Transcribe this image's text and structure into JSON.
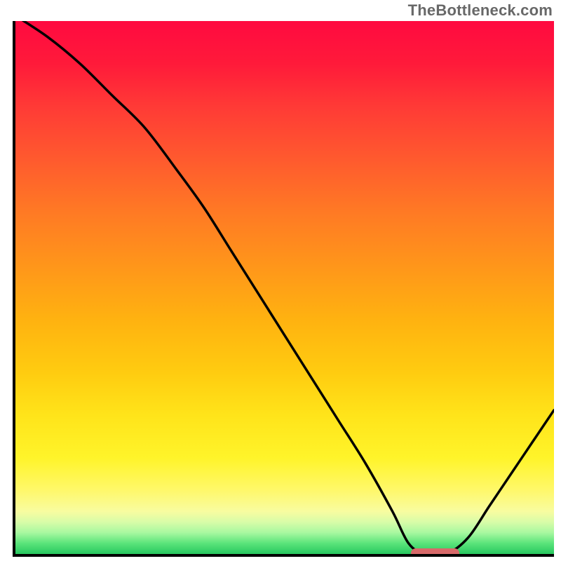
{
  "watermark": "TheBottleneck.com",
  "colors": {
    "axis": "#000000",
    "curve": "#000000",
    "marker": "#d86a6a",
    "gradient_top": "#ff0a40",
    "gradient_bottom": "#28c860"
  },
  "chart_data": {
    "type": "line",
    "title": "",
    "xlabel": "",
    "ylabel": "",
    "xlim": [
      0,
      100
    ],
    "ylim": [
      0,
      100
    ],
    "x": [
      0,
      6,
      12,
      18,
      24,
      30,
      35,
      40,
      45,
      50,
      55,
      60,
      65,
      70,
      73,
      76,
      80,
      84,
      88,
      92,
      96,
      100
    ],
    "values": [
      101,
      97,
      92,
      86,
      80,
      72,
      65,
      57,
      49,
      41,
      33,
      25,
      17,
      8,
      2,
      0,
      0,
      3,
      9,
      15,
      21,
      27
    ],
    "marker": {
      "x_start": 73,
      "x_end": 82,
      "y": 0.7
    },
    "notes": "Axes have no tick labels; y≈100 at left edge descending to a flat minimum near x≈73–82 then rising; values estimated from curve shape."
  }
}
